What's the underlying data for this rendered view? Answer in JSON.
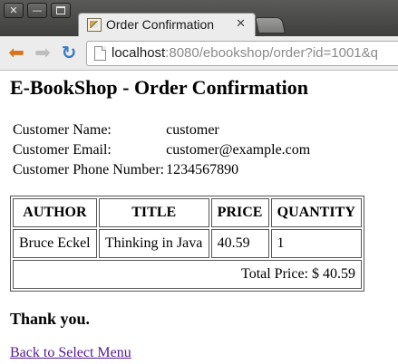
{
  "browser": {
    "tab_title": "Order Confirmation",
    "url_host": "localhost",
    "url_path": ":8080/ebookshop/order?id=1001&q"
  },
  "page": {
    "heading": "E-BookShop - Order Confirmation",
    "customer": [
      {
        "label": "Customer Name:",
        "value": "customer"
      },
      {
        "label": "Customer Email:",
        "value": "customer@example.com"
      },
      {
        "label": "Customer Phone Number:",
        "value": "1234567890"
      }
    ],
    "order_table": {
      "headers": [
        "AUTHOR",
        "TITLE",
        "PRICE",
        "QUANTITY"
      ],
      "rows": [
        [
          "Bruce Eckel",
          "Thinking in Java",
          "40.59",
          "1"
        ]
      ],
      "total": "Total Price: $ 40.59"
    },
    "thanks": "Thank you.",
    "back_link": "Back to Select Menu"
  },
  "colors": {
    "link_visited": "#551a8b",
    "back_arrow": "#d8741f",
    "reload": "#3a79c6"
  },
  "icons": {
    "back": "arrow-left",
    "forward": "arrow-right",
    "reload": "reload",
    "page": "page"
  }
}
